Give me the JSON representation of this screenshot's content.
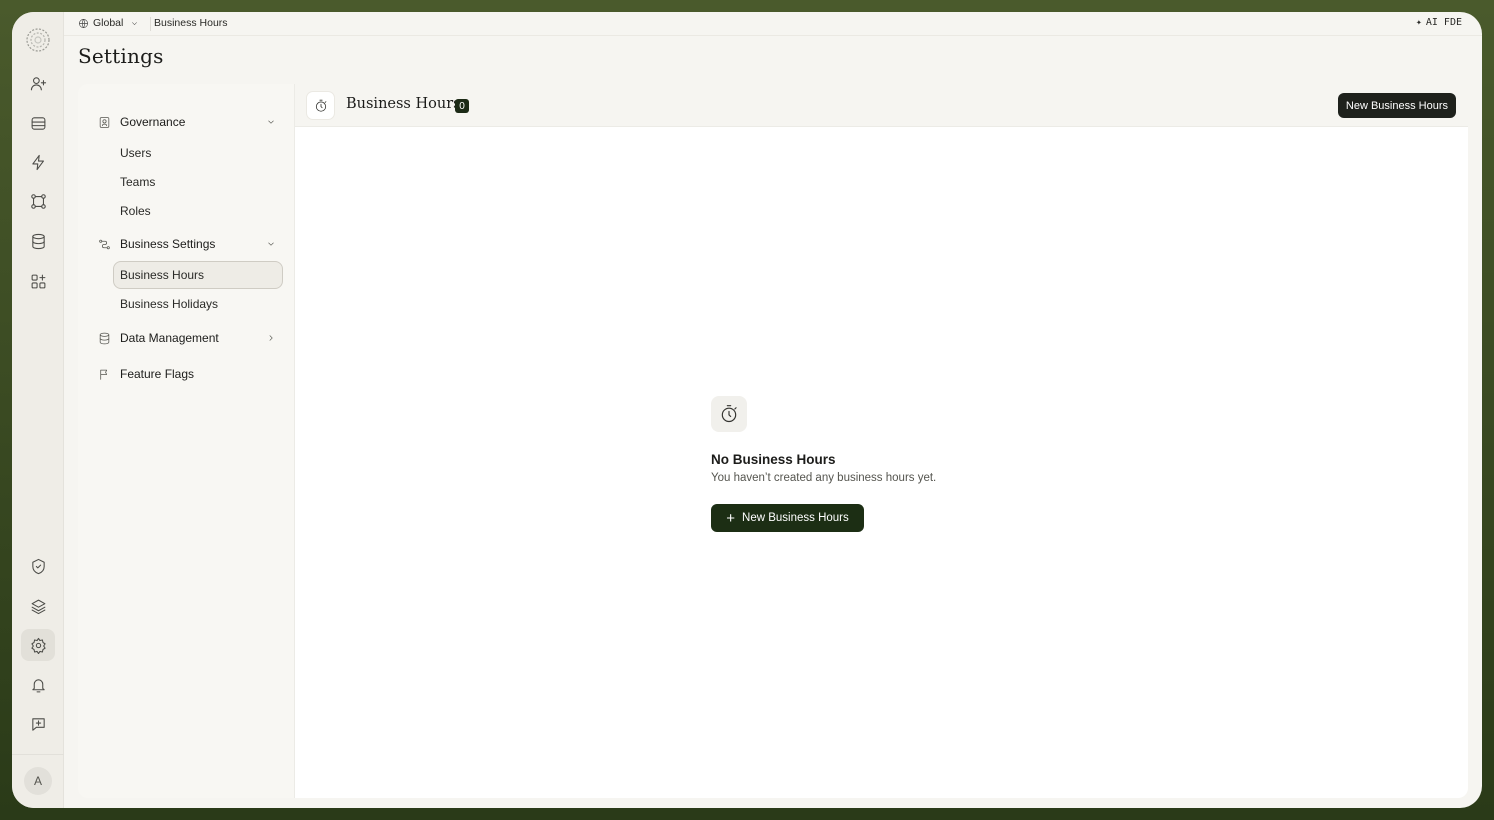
{
  "breadcrumb": {
    "scope": "Global",
    "current": "Business Hours"
  },
  "topbar": {
    "ai_label": "AI FDE"
  },
  "page": {
    "title": "Settings"
  },
  "nav": {
    "governance": {
      "label": "Governance",
      "items": [
        "Users",
        "Teams",
        "Roles"
      ]
    },
    "business_settings": {
      "label": "Business Settings",
      "items": [
        "Business Hours",
        "Business Holidays"
      ]
    },
    "data_management": {
      "label": "Data Management"
    },
    "feature_flags": {
      "label": "Feature Flags"
    }
  },
  "main": {
    "title": "Business Hours",
    "count": "0",
    "new_button": "New Business Hours",
    "empty_title": "No Business Hours",
    "empty_desc": "You haven’t created any business hours yet.",
    "empty_button": "New Business Hours"
  },
  "user": {
    "avatar_initial": "A"
  },
  "colors": {
    "accent": "#1c2e14",
    "frame_bg": "#f6f5f1",
    "outer_bg": "#3a4a22"
  }
}
